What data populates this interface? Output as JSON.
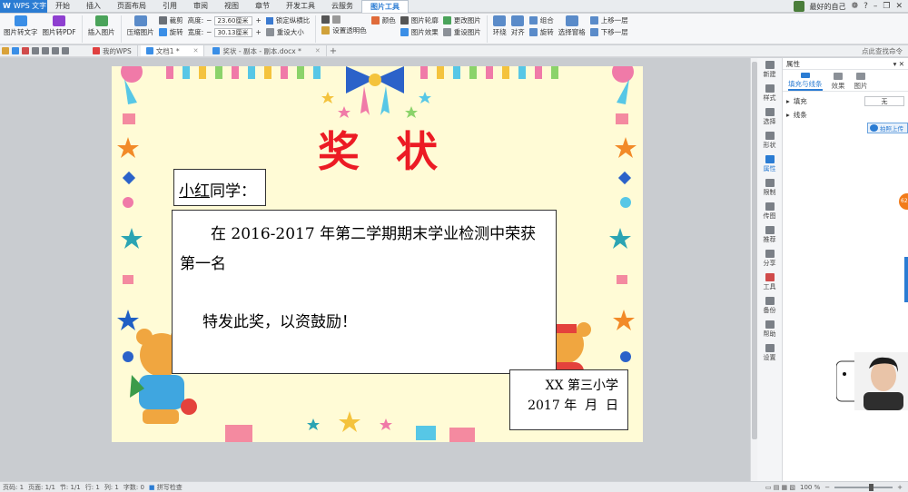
{
  "app": {
    "name": "WPS 文字",
    "logo_letter": "W"
  },
  "menu_tabs": [
    {
      "label": "开始"
    },
    {
      "label": "插入"
    },
    {
      "label": "页面布局"
    },
    {
      "label": "引用"
    },
    {
      "label": "审阅"
    },
    {
      "label": "视图"
    },
    {
      "label": "章节"
    },
    {
      "label": "开发工具"
    },
    {
      "label": "云服务"
    },
    {
      "label": "图片工具"
    }
  ],
  "user": {
    "name": "最好的自己"
  },
  "ribbon": {
    "btn_pic_to_text": "图片转文字",
    "btn_pic_to_pdf": "图片转PDF",
    "btn_insert_pic": "插入图片",
    "btn_compress": "压缩图片",
    "btn_crop": "裁剪",
    "btn_rotate": "旋转",
    "height_label": "高度:",
    "height_value": "23.60厘米",
    "width_label": "宽度:",
    "width_value": "30.13厘米",
    "lock_ratio": "锁定纵横比",
    "reset_size": "重设大小",
    "set_transparent": "设置透明色",
    "color": "颜色",
    "pic_outline": "图片轮廓",
    "pic_effect": "图片效果",
    "change_pic": "更改图片",
    "reset_pic": "重设图片",
    "wrap": "环绕",
    "align": "对齐",
    "group": "组合",
    "rotate2": "旋转",
    "selection_pane": "选择窗格",
    "bring_forward": "上移一层",
    "send_backward": "下移一层"
  },
  "doc_tabs": [
    {
      "label": "我的WPS"
    },
    {
      "label": "文档1 *"
    },
    {
      "label": "奖状 - 副本 - 副本.docx *"
    }
  ],
  "search_cmd": "点此查找命令",
  "certificate": {
    "title": "奖状",
    "recipient_name": "小红",
    "recipient_suffix": "同学：",
    "body_line": "在 2016-2017 年第二学期期末学业检测中荣获第一名",
    "encouragement": "特发此奖，以资鼓励！",
    "issuer": "XX 第三小学",
    "date": "2017 年  月  日"
  },
  "rail": [
    {
      "label": "新建"
    },
    {
      "label": "样式"
    },
    {
      "label": "选择"
    },
    {
      "label": "形状"
    },
    {
      "label": "属性"
    },
    {
      "label": "限制"
    },
    {
      "label": "传图"
    },
    {
      "label": "推荐"
    },
    {
      "label": "分享"
    },
    {
      "label": "工具"
    },
    {
      "label": "备份"
    },
    {
      "label": "帮助"
    },
    {
      "label": "设置"
    }
  ],
  "pane": {
    "title": "属性",
    "tabs": [
      {
        "label": "填充与线条"
      },
      {
        "label": "效果"
      },
      {
        "label": "图片"
      }
    ],
    "fill_label": "填充",
    "fill_value": "无",
    "line_label": "线条",
    "float_btn": "拍照上传",
    "orange_badge": "62"
  },
  "status": {
    "page": "页码: 1",
    "pages": "页面: 1/1",
    "section": "节: 1/1",
    "row": "行: 1",
    "col": "列: 1",
    "words": "字数: 0",
    "spell": "拼写检查",
    "zoom": "100 %"
  },
  "colors": {
    "accent": "#2b7cd3",
    "title_red": "#ec1b24",
    "page_bg": "#fffbd6"
  }
}
